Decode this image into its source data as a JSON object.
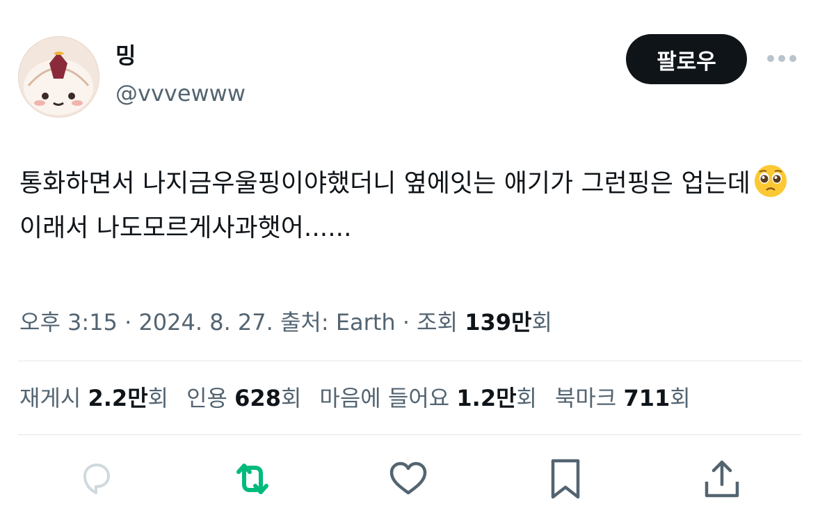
{
  "author": {
    "display_name": "밍",
    "handle": "@vvvewww",
    "follow_label": "팔로우"
  },
  "tweet": {
    "text_part1": "통화하면서 나지금우울핑이야했더니 옆에잇는 애기가 그런핑은 업는데",
    "emoji": "pleading-face",
    "text_part2": " 이래서 나도모르게사과햇어......"
  },
  "meta": {
    "time": "오후 3:15",
    "sep1": " · ",
    "date": "2024. 8. 27.",
    "source_label": " 출처: ",
    "source": "Earth",
    "sep2": " · ",
    "views_label": "조회 ",
    "views_value": "139만",
    "views_unit": "회"
  },
  "stats": [
    {
      "label": "재게시 ",
      "value": "2.2만",
      "unit": "회"
    },
    {
      "label": "인용 ",
      "value": "628",
      "unit": "회"
    },
    {
      "label": "마음에 들어요 ",
      "value": "1.2만",
      "unit": "회"
    },
    {
      "label": "북마크 ",
      "value": "711",
      "unit": "회"
    }
  ],
  "actions": {
    "reply_icon": "reply-icon",
    "retweet_icon": "retweet-icon",
    "like_icon": "heart-icon",
    "bookmark_icon": "bookmark-icon",
    "share_icon": "share-icon"
  },
  "colors": {
    "text_primary": "#0f1419",
    "text_secondary": "#536471",
    "divider": "#e1e5e9",
    "retweeted_green": "#00ba7c",
    "reply_disabled": "#cfd9de",
    "icon_gray": "#536471",
    "follow_bg": "#0f1419"
  }
}
